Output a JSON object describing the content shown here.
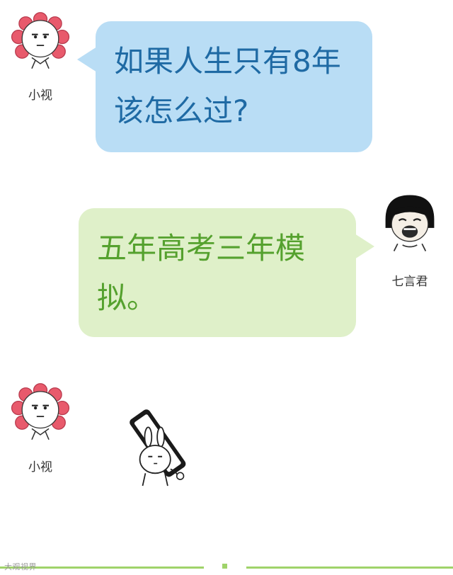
{
  "messages": [
    {
      "sender": "小视",
      "lines": [
        "如果人生只有8年",
        "该怎么过?"
      ],
      "avatar_icon": "sunflower-face-icon",
      "color": "#1f6aa4",
      "bubble_color": "#b9ddf5"
    },
    {
      "sender": "七言君",
      "lines": [
        "五年高考三年模",
        "拟。"
      ],
      "avatar_icon": "bowl-cut-laughing-face-icon",
      "color": "#55a12e",
      "bubble_color": "#dff0c9"
    },
    {
      "sender": "小视",
      "sticker_icon": "rabbit-holding-phone-sticker-icon",
      "avatar_icon": "sunflower-face-icon"
    }
  ],
  "footer": {
    "watermark": "大观视界",
    "line_color": "#9fd36a"
  }
}
